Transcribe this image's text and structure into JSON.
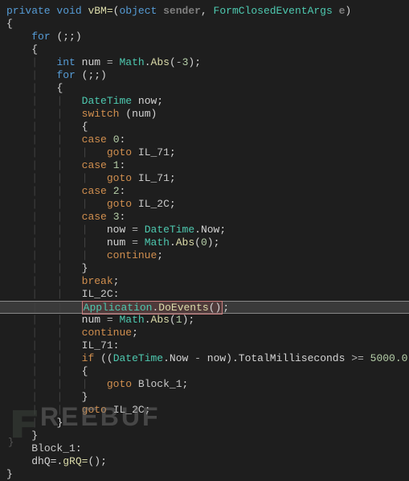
{
  "code": {
    "lines": [
      {
        "indent": 0,
        "tokens": [
          [
            "kw",
            "private"
          ],
          [
            "",
            ". "
          ],
          [
            "kw",
            "void"
          ],
          [
            "",
            ". "
          ],
          [
            "meth",
            "vBM="
          ],
          [
            "punc",
            "("
          ],
          [
            "kw",
            "object"
          ],
          [
            "",
            ". "
          ],
          [
            "param",
            "sender"
          ],
          [
            "punc",
            ","
          ],
          [
            "",
            ". "
          ],
          [
            "type",
            "FormClosedEventArgs"
          ],
          [
            "",
            ". "
          ],
          [
            "param",
            "e"
          ],
          [
            "punc",
            ")"
          ]
        ],
        "raw_indent": ""
      },
      {
        "raw_indent": "",
        "tokens": [
          [
            "punc",
            "{"
          ]
        ]
      },
      {
        "raw_indent": "    ",
        "tokens": [
          [
            "kw",
            "for"
          ],
          [
            "",
            ". "
          ],
          [
            "punc",
            "(;;)"
          ]
        ]
      },
      {
        "raw_indent": "    ",
        "tokens": [
          [
            "punc",
            "{"
          ]
        ]
      },
      {
        "raw_indent": "        ",
        "guides": 1,
        "tokens": [
          [
            "kw",
            "int"
          ],
          [
            "",
            ". "
          ],
          [
            "ident",
            "num"
          ],
          [
            "",
            ". "
          ],
          [
            "op",
            "="
          ],
          [
            "",
            ". "
          ],
          [
            "type",
            "Math"
          ],
          [
            "punc",
            "."
          ],
          [
            "meth",
            "Abs"
          ],
          [
            "punc",
            "("
          ],
          [
            "op",
            "-"
          ],
          [
            "num",
            "3"
          ],
          [
            "punc",
            ")"
          ],
          [
            "punc",
            ";"
          ]
        ]
      },
      {
        "raw_indent": "        ",
        "guides": 1,
        "tokens": [
          [
            "kw",
            "for"
          ],
          [
            "",
            ". "
          ],
          [
            "punc",
            "(;;)"
          ]
        ]
      },
      {
        "raw_indent": "        ",
        "guides": 1,
        "tokens": [
          [
            "punc",
            "{"
          ]
        ]
      },
      {
        "raw_indent": "            ",
        "guides": 2,
        "tokens": [
          [
            "type",
            "DateTime"
          ],
          [
            "",
            ". "
          ],
          [
            "ident",
            "now"
          ],
          [
            "punc",
            ";"
          ]
        ]
      },
      {
        "raw_indent": "            ",
        "guides": 2,
        "tokens": [
          [
            "flow",
            "switch"
          ],
          [
            "",
            ". "
          ],
          [
            "punc",
            "("
          ],
          [
            "ident",
            "num"
          ],
          [
            "punc",
            ")"
          ]
        ]
      },
      {
        "raw_indent": "            ",
        "guides": 2,
        "tokens": [
          [
            "punc",
            "{"
          ]
        ]
      },
      {
        "raw_indent": "            ",
        "guides": 2,
        "tokens": [
          [
            "flow",
            "case"
          ],
          [
            "",
            ". "
          ],
          [
            "num",
            "0"
          ],
          [
            "punc",
            ":"
          ]
        ]
      },
      {
        "raw_indent": "                ",
        "guides": 3,
        "tokens": [
          [
            "flow",
            "goto"
          ],
          [
            "",
            ". "
          ],
          [
            "label",
            "IL_71"
          ],
          [
            "punc",
            ";"
          ]
        ]
      },
      {
        "raw_indent": "            ",
        "guides": 2,
        "tokens": [
          [
            "flow",
            "case"
          ],
          [
            "",
            ". "
          ],
          [
            "num",
            "1"
          ],
          [
            "punc",
            ":"
          ]
        ]
      },
      {
        "raw_indent": "                ",
        "guides": 3,
        "tokens": [
          [
            "flow",
            "goto"
          ],
          [
            "",
            ". "
          ],
          [
            "label",
            "IL_71"
          ],
          [
            "punc",
            ";"
          ]
        ]
      },
      {
        "raw_indent": "            ",
        "guides": 2,
        "tokens": [
          [
            "flow",
            "case"
          ],
          [
            "",
            ". "
          ],
          [
            "num",
            "2"
          ],
          [
            "punc",
            ":"
          ]
        ]
      },
      {
        "raw_indent": "                ",
        "guides": 3,
        "tokens": [
          [
            "flow",
            "goto"
          ],
          [
            "",
            ". "
          ],
          [
            "label",
            "IL_2C"
          ],
          [
            "punc",
            ";"
          ]
        ]
      },
      {
        "raw_indent": "            ",
        "guides": 2,
        "tokens": [
          [
            "flow",
            "case"
          ],
          [
            "",
            ". "
          ],
          [
            "num",
            "3"
          ],
          [
            "punc",
            ":"
          ]
        ]
      },
      {
        "raw_indent": "                ",
        "guides": 3,
        "tokens": [
          [
            "ident",
            "now"
          ],
          [
            "",
            ". "
          ],
          [
            "op",
            "="
          ],
          [
            "",
            ". "
          ],
          [
            "type",
            "DateTime"
          ],
          [
            "punc",
            "."
          ],
          [
            "ident",
            "Now"
          ],
          [
            "punc",
            ";"
          ]
        ]
      },
      {
        "raw_indent": "                ",
        "guides": 3,
        "tokens": [
          [
            "ident",
            "num"
          ],
          [
            "",
            ". "
          ],
          [
            "op",
            "="
          ],
          [
            "",
            ". "
          ],
          [
            "type",
            "Math"
          ],
          [
            "punc",
            "."
          ],
          [
            "meth",
            "Abs"
          ],
          [
            "punc",
            "("
          ],
          [
            "num",
            "0"
          ],
          [
            "punc",
            ")"
          ],
          [
            "punc",
            ";"
          ]
        ]
      },
      {
        "raw_indent": "                ",
        "guides": 3,
        "tokens": [
          [
            "flow",
            "continue"
          ],
          [
            "punc",
            ";"
          ]
        ]
      },
      {
        "raw_indent": "            ",
        "guides": 2,
        "tokens": [
          [
            "punc",
            "}"
          ]
        ]
      },
      {
        "raw_indent": "            ",
        "guides": 2,
        "tokens": [
          [
            "flow",
            "break"
          ],
          [
            "punc",
            ";"
          ]
        ]
      },
      {
        "raw_indent": "            ",
        "guides": 2,
        "tokens": [
          [
            "label",
            "IL_2C"
          ],
          [
            "punc",
            ":"
          ]
        ]
      },
      {
        "raw_indent": "            ",
        "guides": 2,
        "highlight": true,
        "selbox": true,
        "tokens": [
          [
            "type",
            "Application"
          ],
          [
            "punc",
            "."
          ],
          [
            "meth",
            "DoEvents"
          ],
          [
            "punc",
            "()"
          ]
        ],
        "after_sel": [
          [
            "punc",
            ";"
          ]
        ]
      },
      {
        "raw_indent": "            ",
        "guides": 2,
        "tokens": [
          [
            "ident",
            "num"
          ],
          [
            "",
            ". "
          ],
          [
            "op",
            "="
          ],
          [
            "",
            ". "
          ],
          [
            "type",
            "Math"
          ],
          [
            "punc",
            "."
          ],
          [
            "meth",
            "Abs"
          ],
          [
            "punc",
            "("
          ],
          [
            "num",
            "1"
          ],
          [
            "punc",
            ")"
          ],
          [
            "punc",
            ";"
          ]
        ]
      },
      {
        "raw_indent": "            ",
        "guides": 2,
        "tokens": [
          [
            "flow",
            "continue"
          ],
          [
            "punc",
            ";"
          ]
        ]
      },
      {
        "raw_indent": "            ",
        "guides": 2,
        "tokens": [
          [
            "label",
            "IL_71"
          ],
          [
            "punc",
            ":"
          ]
        ]
      },
      {
        "raw_indent": "            ",
        "guides": 2,
        "tokens": [
          [
            "flow",
            "if"
          ],
          [
            "",
            ". "
          ],
          [
            "punc",
            "(("
          ],
          [
            "type",
            "DateTime"
          ],
          [
            "punc",
            "."
          ],
          [
            "ident",
            "Now"
          ],
          [
            "",
            ". "
          ],
          [
            "op",
            "-"
          ],
          [
            "",
            ". "
          ],
          [
            "ident",
            "now"
          ],
          [
            "punc",
            ")."
          ],
          [
            "ident",
            "TotalMilliseconds"
          ],
          [
            "",
            ". "
          ],
          [
            "op",
            ">="
          ],
          [
            "",
            ". "
          ],
          [
            "num",
            "5000.0"
          ],
          [
            "punc",
            ")"
          ]
        ]
      },
      {
        "raw_indent": "            ",
        "guides": 2,
        "tokens": [
          [
            "punc",
            "{"
          ]
        ]
      },
      {
        "raw_indent": "                ",
        "guides": 3,
        "tokens": [
          [
            "flow",
            "goto"
          ],
          [
            "",
            ". "
          ],
          [
            "label",
            "Block_1"
          ],
          [
            "punc",
            ";"
          ]
        ]
      },
      {
        "raw_indent": "            ",
        "guides": 2,
        "tokens": [
          [
            "punc",
            "}"
          ]
        ]
      },
      {
        "raw_indent": "            ",
        "guides": 2,
        "tokens": [
          [
            "flow",
            "goto"
          ],
          [
            "",
            ". "
          ],
          [
            "label",
            "IL_2C"
          ],
          [
            "punc",
            ";"
          ]
        ]
      },
      {
        "raw_indent": "        ",
        "guides": 1,
        "tokens": [
          [
            "punc",
            "}"
          ]
        ]
      },
      {
        "raw_indent": "    ",
        "tokens": [
          [
            "punc",
            "}"
          ]
        ]
      },
      {
        "raw_indent": "    ",
        "tokens": [
          [
            "label",
            "Block_1"
          ],
          [
            "punc",
            ":"
          ]
        ]
      },
      {
        "raw_indent": "    ",
        "tokens": [
          [
            "ident",
            "dhQ="
          ],
          [
            "punc",
            "."
          ],
          [
            "meth",
            "gRQ="
          ],
          [
            "punc",
            "()"
          ],
          [
            "punc",
            ";"
          ]
        ]
      },
      {
        "raw_indent": "",
        "tokens": [
          [
            "punc",
            "}"
          ]
        ]
      }
    ]
  },
  "watermark": {
    "text": "REEBUF"
  },
  "footer": {
    "text": "}"
  }
}
